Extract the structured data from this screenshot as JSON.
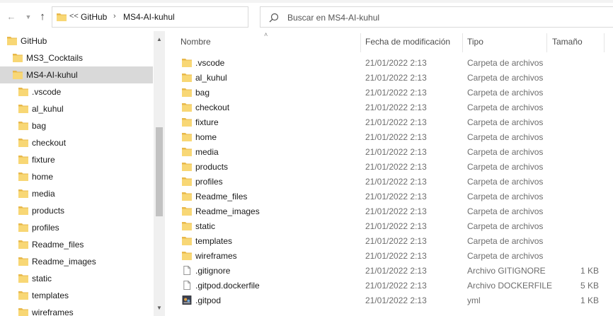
{
  "address_bar": {
    "overflow": "<<",
    "crumbs": [
      "GitHub",
      "MS4-AI-kuhul"
    ]
  },
  "search": {
    "placeholder": "Buscar en MS4-AI-kuhul"
  },
  "nav_tree": [
    {
      "label": "GitHub",
      "level": 0,
      "selected": false
    },
    {
      "label": "MS3_Cocktails",
      "level": 1,
      "selected": false
    },
    {
      "label": "MS4-AI-kuhul",
      "level": 1,
      "selected": true
    },
    {
      "label": ".vscode",
      "level": 2,
      "selected": false
    },
    {
      "label": "al_kuhul",
      "level": 2,
      "selected": false
    },
    {
      "label": "bag",
      "level": 2,
      "selected": false
    },
    {
      "label": "checkout",
      "level": 2,
      "selected": false
    },
    {
      "label": "fixture",
      "level": 2,
      "selected": false
    },
    {
      "label": "home",
      "level": 2,
      "selected": false
    },
    {
      "label": "media",
      "level": 2,
      "selected": false
    },
    {
      "label": "products",
      "level": 2,
      "selected": false
    },
    {
      "label": "profiles",
      "level": 2,
      "selected": false
    },
    {
      "label": "Readme_files",
      "level": 2,
      "selected": false
    },
    {
      "label": "Readme_images",
      "level": 2,
      "selected": false
    },
    {
      "label": "static",
      "level": 2,
      "selected": false
    },
    {
      "label": "templates",
      "level": 2,
      "selected": false
    },
    {
      "label": "wireframes",
      "level": 2,
      "selected": false
    }
  ],
  "columns": {
    "name": "Nombre",
    "date": "Fecha de modificación",
    "type": "Tipo",
    "size": "Tamaño"
  },
  "files": [
    {
      "name": ".vscode",
      "date": "21/01/2022 2:13",
      "type": "Carpeta de archivos",
      "size": "",
      "icon": "folder-icon"
    },
    {
      "name": "al_kuhul",
      "date": "21/01/2022 2:13",
      "type": "Carpeta de archivos",
      "size": "",
      "icon": "folder-icon"
    },
    {
      "name": "bag",
      "date": "21/01/2022 2:13",
      "type": "Carpeta de archivos",
      "size": "",
      "icon": "folder-icon"
    },
    {
      "name": "checkout",
      "date": "21/01/2022 2:13",
      "type": "Carpeta de archivos",
      "size": "",
      "icon": "folder-icon"
    },
    {
      "name": "fixture",
      "date": "21/01/2022 2:13",
      "type": "Carpeta de archivos",
      "size": "",
      "icon": "folder-icon"
    },
    {
      "name": "home",
      "date": "21/01/2022 2:13",
      "type": "Carpeta de archivos",
      "size": "",
      "icon": "folder-icon"
    },
    {
      "name": "media",
      "date": "21/01/2022 2:13",
      "type": "Carpeta de archivos",
      "size": "",
      "icon": "folder-icon"
    },
    {
      "name": "products",
      "date": "21/01/2022 2:13",
      "type": "Carpeta de archivos",
      "size": "",
      "icon": "folder-icon"
    },
    {
      "name": "profiles",
      "date": "21/01/2022 2:13",
      "type": "Carpeta de archivos",
      "size": "",
      "icon": "folder-icon"
    },
    {
      "name": "Readme_files",
      "date": "21/01/2022 2:13",
      "type": "Carpeta de archivos",
      "size": "",
      "icon": "folder-icon"
    },
    {
      "name": "Readme_images",
      "date": "21/01/2022 2:13",
      "type": "Carpeta de archivos",
      "size": "",
      "icon": "folder-icon"
    },
    {
      "name": "static",
      "date": "21/01/2022 2:13",
      "type": "Carpeta de archivos",
      "size": "",
      "icon": "folder-icon"
    },
    {
      "name": "templates",
      "date": "21/01/2022 2:13",
      "type": "Carpeta de archivos",
      "size": "",
      "icon": "folder-icon"
    },
    {
      "name": "wireframes",
      "date": "21/01/2022 2:13",
      "type": "Carpeta de archivos",
      "size": "",
      "icon": "folder-icon"
    },
    {
      "name": ".gitignore",
      "date": "21/01/2022 2:13",
      "type": "Archivo GITIGNORE",
      "size": "1 KB",
      "icon": "file-icon"
    },
    {
      "name": ".gitpod.dockerfile",
      "date": "21/01/2022 2:13",
      "type": "Archivo DOCKERFILE",
      "size": "5 KB",
      "icon": "file-icon"
    },
    {
      "name": ".gitpod",
      "date": "21/01/2022 2:13",
      "type": "yml",
      "size": "1 KB",
      "icon": "yml-file-icon"
    }
  ],
  "colors": {
    "folder": "#f8d775",
    "folder_dark": "#e8b84a",
    "selected": "#d9d9d9"
  }
}
